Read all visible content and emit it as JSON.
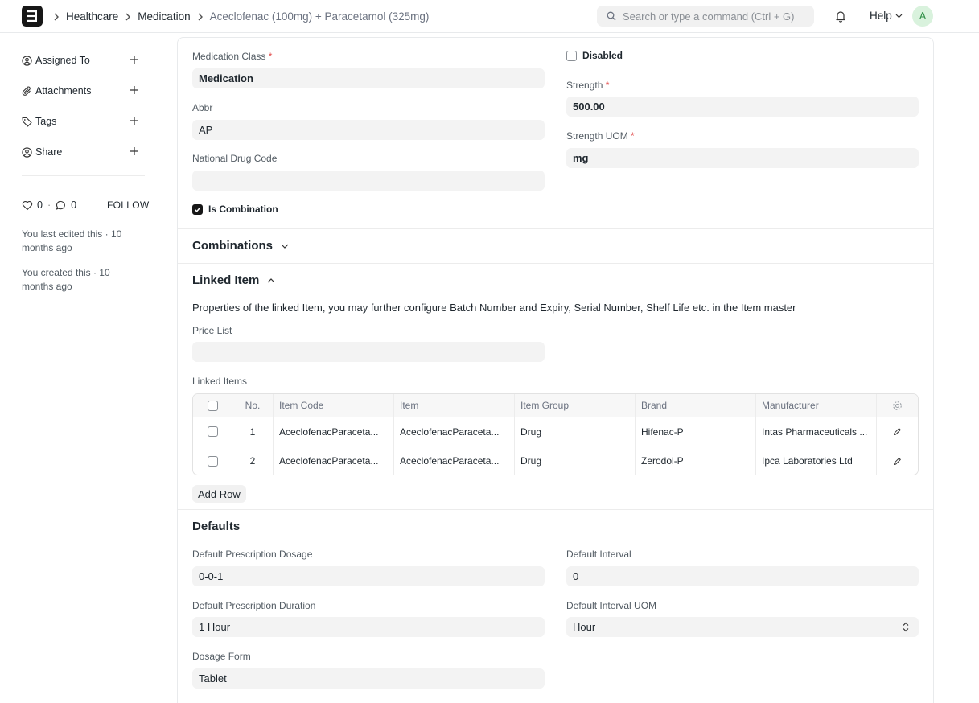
{
  "navbar": {
    "breadcrumbs": [
      "Healthcare",
      "Medication",
      "Aceclofenac (100mg) + Paracetamol (325mg)"
    ],
    "search_placeholder": "Search or type a command (Ctrl + G)",
    "help_label": "Help",
    "avatar_initial": "A"
  },
  "sidebar": {
    "items": [
      {
        "label": "Assigned To",
        "icon": "user-assign-icon"
      },
      {
        "label": "Attachments",
        "icon": "paperclip-icon"
      },
      {
        "label": "Tags",
        "icon": "tag-icon"
      },
      {
        "label": "Share",
        "icon": "share-user-icon"
      }
    ],
    "likes": "0",
    "comments": "0",
    "follow_label": "FOLLOW",
    "activity": [
      "You last edited this · 10 months ago",
      "You created this · 10 months ago"
    ]
  },
  "form": {
    "medication_class": {
      "label": "Medication Class",
      "value": "Medication",
      "required": "*"
    },
    "abbr": {
      "label": "Abbr",
      "value": "AP"
    },
    "national_drug_code": {
      "label": "National Drug Code",
      "value": ""
    },
    "is_combination": {
      "label": "Is Combination",
      "checked": true
    },
    "disabled": {
      "label": "Disabled",
      "checked": false
    },
    "strength": {
      "label": "Strength",
      "value": "500.00",
      "required": "*"
    },
    "strength_uom": {
      "label": "Strength UOM",
      "value": "mg",
      "required": "*"
    }
  },
  "sections": {
    "combinations": "Combinations",
    "linked_item": "Linked Item",
    "linked_item_desc": "Properties of the linked Item, you may further configure Batch Number and Expiry, Serial Number, Shelf Life etc. in the Item master",
    "defaults": "Defaults"
  },
  "linked": {
    "price_list": {
      "label": "Price List",
      "value": ""
    },
    "table_label": "Linked Items",
    "columns": [
      "No.",
      "Item Code",
      "Item",
      "Item Group",
      "Brand",
      "Manufacturer"
    ],
    "rows": [
      {
        "no": "1",
        "item_code": "AceclofenacParaceta...",
        "item": "AceclofenacParaceta...",
        "group": "Drug",
        "brand": "Hifenac-P",
        "manufacturer": "Intas Pharmaceuticals ..."
      },
      {
        "no": "2",
        "item_code": "AceclofenacParaceta...",
        "item": "AceclofenacParaceta...",
        "group": "Drug",
        "brand": "Zerodol-P",
        "manufacturer": "Ipca Laboratories Ltd"
      }
    ],
    "add_row_label": "Add Row"
  },
  "defaults": {
    "prescription_dosage": {
      "label": "Default Prescription Dosage",
      "value": "0-0-1"
    },
    "prescription_duration": {
      "label": "Default Prescription Duration",
      "value": "1 Hour"
    },
    "dosage_form": {
      "label": "Dosage Form",
      "value": "Tablet"
    },
    "interval": {
      "label": "Default Interval",
      "value": "0"
    },
    "interval_uom": {
      "label": "Default Interval UOM",
      "value": "Hour"
    }
  }
}
